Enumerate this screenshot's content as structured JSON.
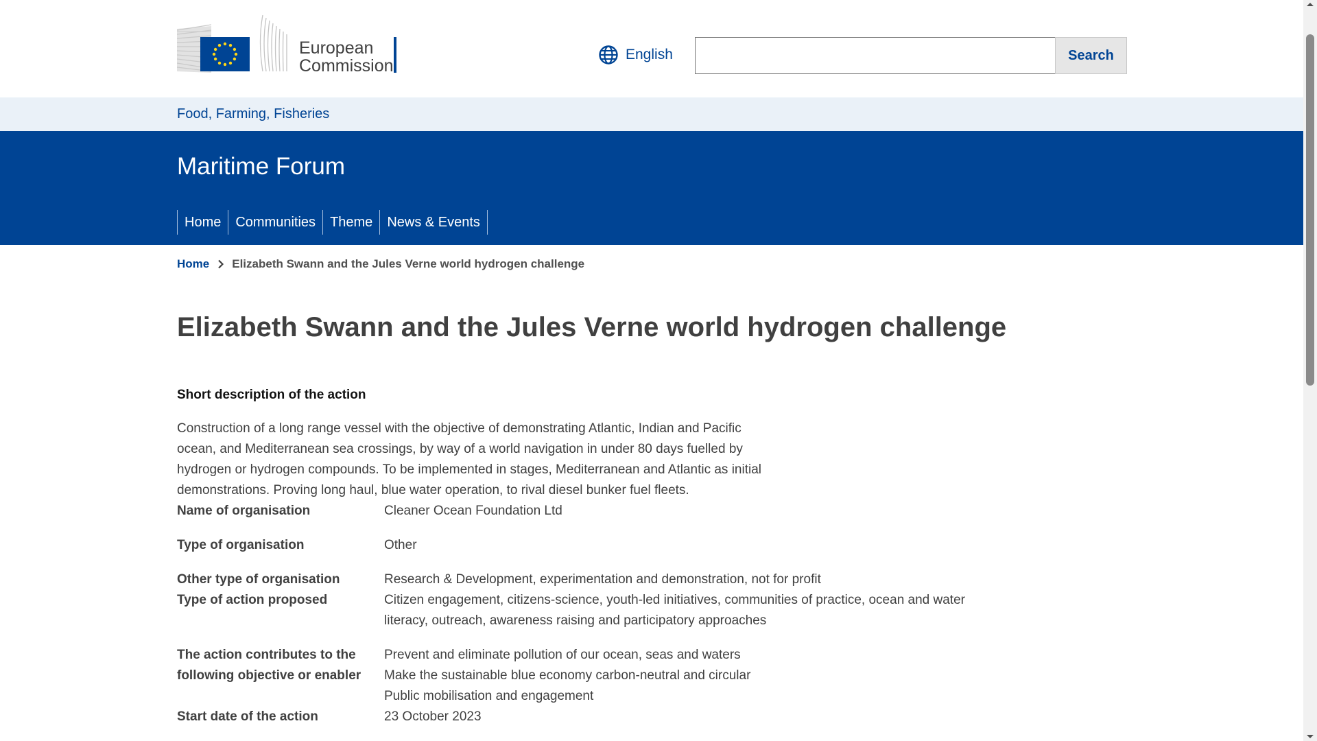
{
  "header": {
    "logo_text_line1": "European",
    "logo_text_line2": "Commission",
    "language_label": "English",
    "search_placeholder": "",
    "search_button_label": "Search"
  },
  "site_bar": {
    "link": "Food, Farming, Fisheries"
  },
  "banner": {
    "title": "Maritime Forum",
    "nav": [
      "Home",
      "Communities",
      "Theme",
      "News & Events"
    ]
  },
  "breadcrumb": {
    "home": "Home",
    "current": "Elizabeth Swann and the Jules Verne world hydrogen challenge"
  },
  "page": {
    "title": "Elizabeth Swann and the Jules Verne world hydrogen challenge",
    "short_description_heading": "Short description of the action",
    "short_description": "Construction of a long range vessel with the objective of demonstrating Atlantic, Indian and Pacific ocean, and Mediterranean sea crossings, by way of a world navigation in under 80 days fuelled by hydrogen or hydrogen compounds. To be implemented in stages, Mediterranean and Atlantic as initial demonstrations. Proving long haul, blue water operation, to rival diesel bunker fuel fleets.",
    "details": [
      {
        "label": "Name of organisation",
        "values": [
          "Cleaner Ocean Foundation Ltd"
        ]
      },
      {
        "label": "Type of organisation",
        "values": [
          "Other"
        ]
      },
      {
        "label": "Other type of organisation",
        "values": [
          "Research & Development, experimentation and demonstration, not for profit"
        ]
      },
      {
        "label": "Type of action proposed",
        "values": [
          "Citizen engagement, citizens-science, youth-led initiatives, communities of practice, ocean and water literacy, outreach, awareness raising and participatory approaches"
        ]
      },
      {
        "label": "The action contributes to the following objective or enabler",
        "values": [
          "Prevent and eliminate pollution of our ocean, seas and waters",
          "Make the sustainable blue economy carbon-neutral and circular",
          "Public mobilisation and engagement"
        ]
      },
      {
        "label": "Start date of the action",
        "values": [
          "23 October 2023"
        ]
      }
    ]
  },
  "colors": {
    "brand_blue": "#004494",
    "site_bar_bg": "#eaf1f8",
    "text": "#404040",
    "eu_flag_blue": "#004494",
    "eu_flag_star": "#ffd617"
  }
}
